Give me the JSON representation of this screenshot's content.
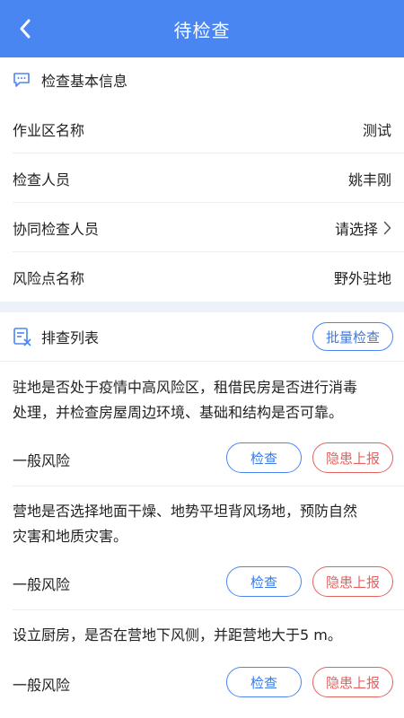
{
  "header": {
    "title": "待检查",
    "back_icon": "chevron-left-icon"
  },
  "basic_info": {
    "section_title": "检查基本信息",
    "section_icon": "chat-bubble-icon",
    "fields": [
      {
        "label": "作业区名称",
        "value": "测试"
      },
      {
        "label": "检查人员",
        "value": "姚丰刚"
      },
      {
        "label": "协同检查人员",
        "value": "请选择"
      },
      {
        "label": "风险点名称",
        "value": "野外驻地"
      }
    ]
  },
  "checklist": {
    "section_title": "排查列表",
    "section_icon": "checklist-icon",
    "batch_button": "批量检查",
    "items": [
      {
        "line1": "驻地是否处于疫情中高风险区，租借民房是否进行消毒",
        "line2": "处理，并检查房屋周边环境、基础和结构是否可靠。",
        "risk": "一般风险",
        "check_label": "检查",
        "report_label": "隐患上报"
      },
      {
        "line1": "营地是否选择地面干燥、地势平坦背风场地，预防自然",
        "line2": "灾害和地质灾害。",
        "risk": "一般风险",
        "check_label": "检查",
        "report_label": "隐患上报"
      },
      {
        "line1": "设立厨房，是否在营地下风侧，并距营地大于5 m。",
        "line2": "",
        "risk": "一般风险",
        "check_label": "检查",
        "report_label": "隐患上报"
      }
    ]
  },
  "colors": {
    "primary": "#4a86f2",
    "danger": "#e3625f",
    "gap": "#edf2fa"
  }
}
